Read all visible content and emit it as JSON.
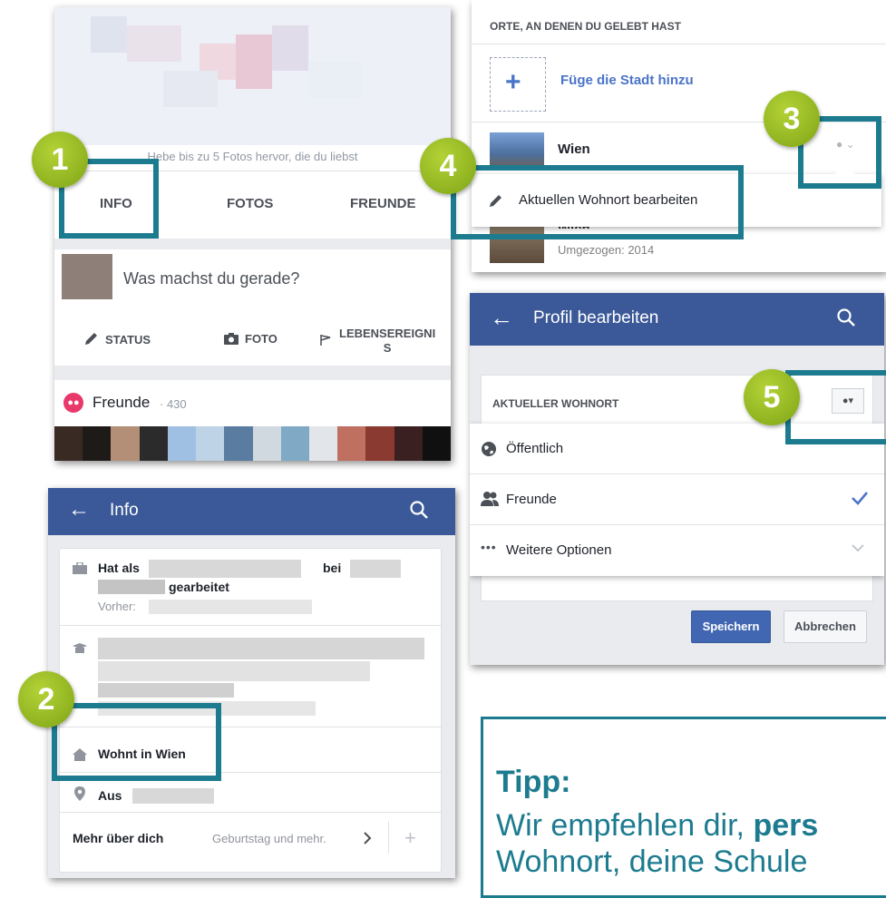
{
  "panel1": {
    "cover_hint": "Hebe bis zu 5 Fotos hervor, die du liebst",
    "tabs": [
      "INFO",
      "FOTOS",
      "FREUNDE"
    ],
    "composer_placeholder": "Was machst du gerade?",
    "actions": [
      "STATUS",
      "FOTO",
      "LEBENSEREIGNI",
      "S"
    ],
    "friends_label": "Freunde",
    "friends_count": "· 430"
  },
  "panel2": {
    "section_title": "ORTE, AN DENEN DU GELEBT HAST",
    "add_city": "Füge die Stadt hinzu",
    "city": "Wien",
    "menu_item": "Aktuellen Wohnort bearbeiten",
    "city2": "Wien",
    "moved": "Umgezogen: 2014"
  },
  "panel3": {
    "title": "Profil bearbeiten",
    "section": "AKTUELLER WOHNORT",
    "options": [
      "Öffentlich",
      "Freunde",
      "Weitere Optionen"
    ],
    "save": "Speichern",
    "cancel": "Abbrechen"
  },
  "panel4": {
    "title": "Info",
    "work_prefix": "Hat als",
    "work_mid": "bei",
    "work_suffix": "gearbeitet",
    "previous": "Vorher:",
    "lives_prefix": "Wohnt in",
    "lives_city": "Wien",
    "from": "Aus",
    "more": "Mehr über dich",
    "more_hint": "Geburtstag und mehr."
  },
  "badges": [
    "1",
    "2",
    "3",
    "4",
    "5"
  ],
  "tip": {
    "title": "Tipp:",
    "line1_a": "Wir empfehlen dir, ",
    "line1_b": "pers",
    "line2": "Wohnort, deine Schule"
  },
  "colors": {
    "fb_blue": "#3b5998",
    "badge_green": "#8fb81e",
    "highlight": "#1c7b8f",
    "tip_text": "#1c7b8f",
    "link_blue": "#4a74c9"
  }
}
